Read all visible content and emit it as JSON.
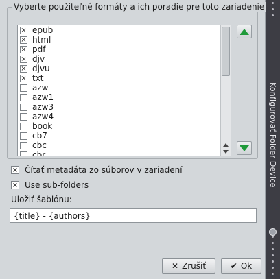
{
  "group": {
    "title": "Vyberte použiteľné formáty a ich poradie pre toto zariadenie"
  },
  "formats": [
    {
      "label": "epub",
      "checked": true
    },
    {
      "label": "html",
      "checked": true
    },
    {
      "label": "pdf",
      "checked": true
    },
    {
      "label": "djv",
      "checked": true
    },
    {
      "label": "djvu",
      "checked": true
    },
    {
      "label": "txt",
      "checked": true
    },
    {
      "label": "azw",
      "checked": false
    },
    {
      "label": "azw1",
      "checked": false
    },
    {
      "label": "azw3",
      "checked": false
    },
    {
      "label": "azw4",
      "checked": false
    },
    {
      "label": "book",
      "checked": false
    },
    {
      "label": "cb7",
      "checked": false
    },
    {
      "label": "cbc",
      "checked": false
    },
    {
      "label": "cbr",
      "checked": false
    }
  ],
  "icons": {
    "move_up": "green-triangle-up-icon",
    "move_down": "green-triangle-down-icon",
    "check_mark": "×",
    "cancel": "✕",
    "ok": "✔"
  },
  "options": {
    "read_metadata": {
      "label": "Čítať metadáta zo súborov v zariadení",
      "checked": true
    },
    "use_subfolders": {
      "label": "Use sub-folders",
      "checked": true
    }
  },
  "template": {
    "label": "Uložiť šablónu:",
    "value": "{title} - {authors}"
  },
  "buttons": {
    "cancel": "Zrušiť",
    "ok": "Ok"
  },
  "sidebar": {
    "title": "Konfigurovať Folder Device"
  },
  "colors": {
    "accent_green": "#1f9a3a",
    "sidebar_bg": "#3d3d44"
  }
}
